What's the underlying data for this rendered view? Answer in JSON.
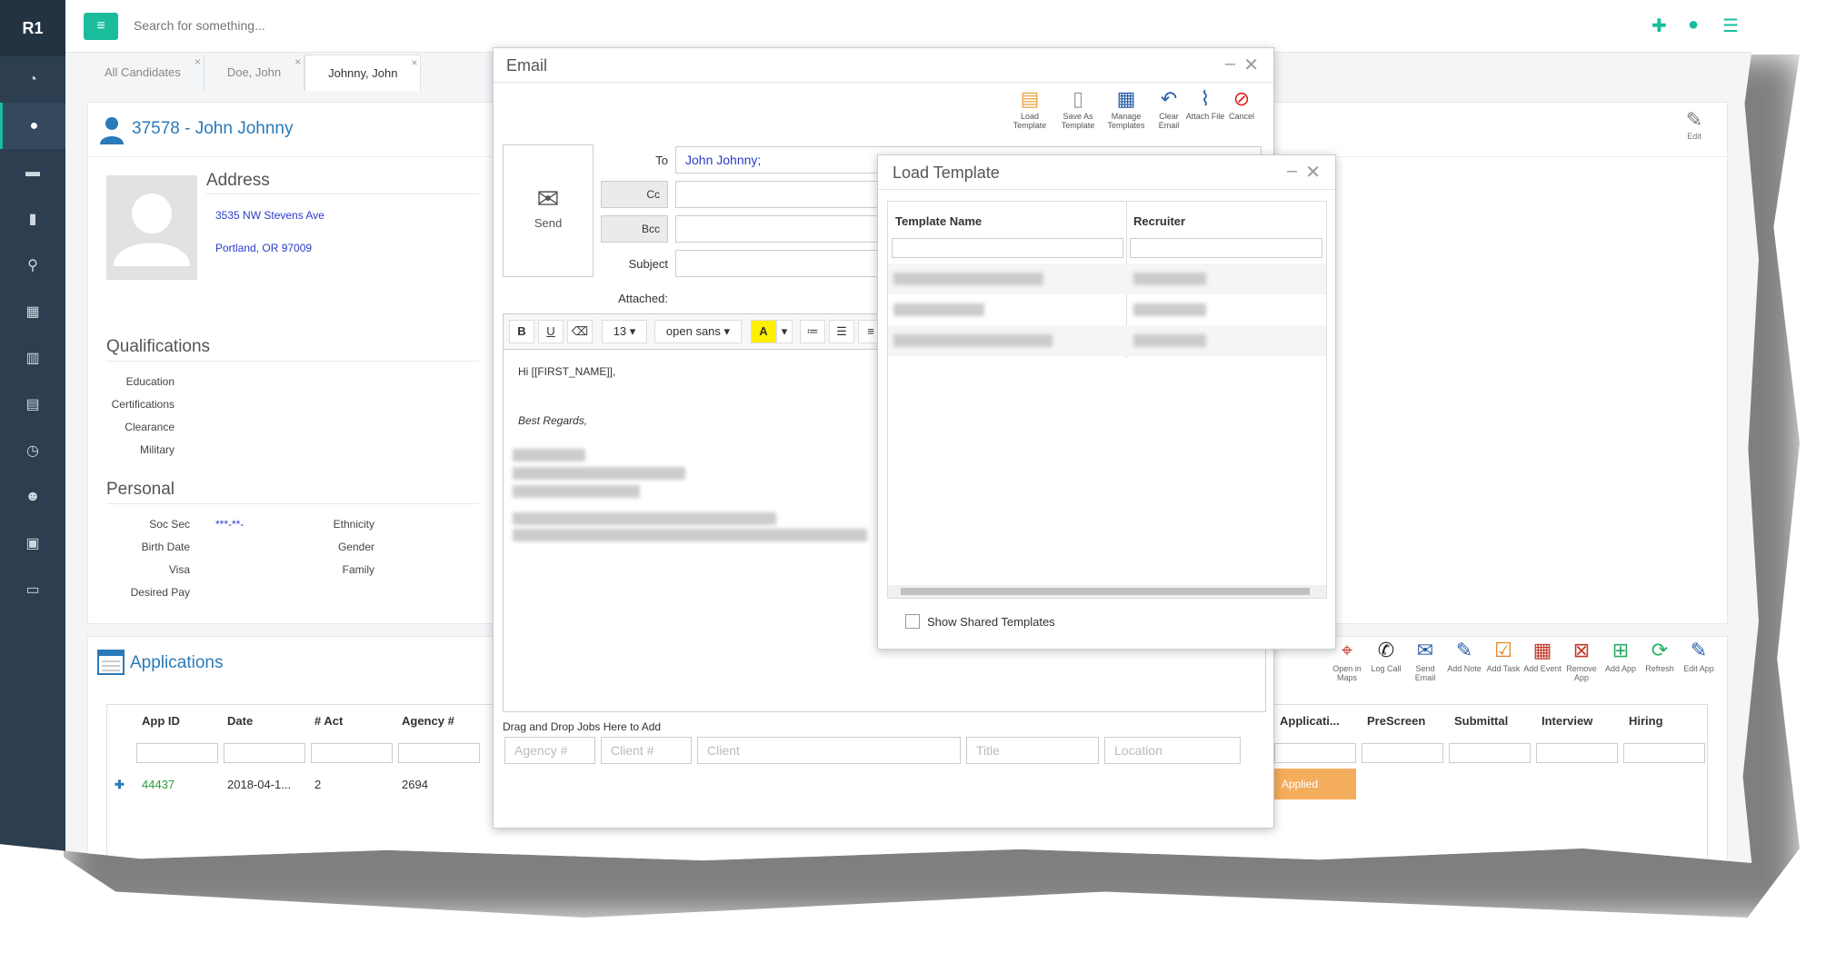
{
  "app": {
    "logo": "R1"
  },
  "topbar": {
    "search_placeholder": "Search for something..."
  },
  "tabs": [
    {
      "label": "All Candidates"
    },
    {
      "label": "Doe, John"
    },
    {
      "label": "Johnny, John"
    }
  ],
  "candidate": {
    "title": "37578 - John Johnny",
    "edit_label": "Edit",
    "address_title": "Address",
    "address_line1": "3535 NW Stevens Ave",
    "address_line2": "Portland, OR 97009",
    "qualifications_title": "Qualifications",
    "qualifications": [
      "Education",
      "Certifications",
      "Clearance",
      "Military"
    ],
    "personal_title": "Personal",
    "soc_sec_label": "Soc Sec",
    "soc_sec_value": "***-**-",
    "birth_date_label": "Birth Date",
    "visa_label": "Visa",
    "desired_pay_label": "Desired Pay",
    "ethnicity_label": "Ethnicity",
    "gender_label": "Gender",
    "family_label": "Family"
  },
  "applications": {
    "title": "Applications",
    "tools": [
      "Open in Maps",
      "Log Call",
      "Send Email",
      "Add Note",
      "Add Task",
      "Add Event",
      "Remove App",
      "Add App",
      "Refresh",
      "Edit App"
    ],
    "columns": [
      "App ID",
      "Date",
      "# Act",
      "Agency #",
      "Applicati...",
      "PreScreen",
      "Submittal",
      "Interview",
      "Hiring"
    ],
    "row": {
      "app_id": "44437",
      "date": "2018-04-1...",
      "act": "2",
      "agency": "2694",
      "status": "Applied"
    },
    "status_color": "#f4ad5c"
  },
  "email": {
    "title": "Email",
    "tools": [
      "Load Template",
      "Save As Template",
      "Manage Templates",
      "Clear Email",
      "Attach File",
      "Cancel"
    ],
    "send_label": "Send",
    "to_label": "To",
    "to_value": "John  Johnny;",
    "cc_label": "Cc",
    "bcc_label": "Bcc",
    "subject_label": "Subject",
    "attached_label": "Attached:",
    "font_size": "13",
    "font_family": "open sans",
    "body_greeting": "Hi [[FIRST_NAME]],",
    "body_closing": "Best Regards,",
    "dnd_label": "Drag and Drop Jobs Here to Add",
    "dnd_fields": [
      "Agency #",
      "Client #",
      "Client",
      "Title",
      "Location"
    ]
  },
  "load_template": {
    "title": "Load Template",
    "col_name": "Template Name",
    "col_recruiter": "Recruiter",
    "show_shared": "Show Shared Templates"
  }
}
